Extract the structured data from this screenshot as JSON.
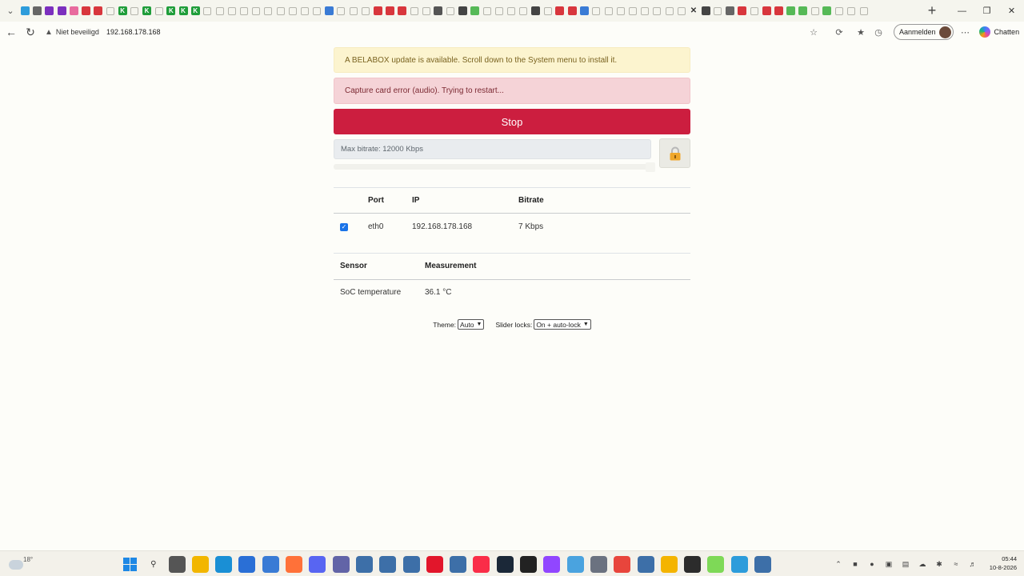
{
  "browser": {
    "tab_favicons": [
      "edge",
      "globe",
      "purple",
      "purple",
      "pink",
      "red",
      "red",
      "gray",
      "green-k",
      "gray",
      "green-k",
      "gray",
      "green-k",
      "green-k",
      "green-k",
      "gray",
      "gray",
      "gray",
      "gray",
      "gray",
      "gray",
      "gray",
      "gray",
      "gray",
      "gray",
      "blue",
      "gray",
      "gray",
      "gray",
      "red",
      "red",
      "red",
      "gray",
      "gray",
      "x",
      "gray",
      "dark",
      "green",
      "gray",
      "gray",
      "gray",
      "gray",
      "dark",
      "gray",
      "red",
      "red",
      "blue",
      "gray",
      "gray",
      "gray",
      "gray",
      "gray",
      "gray",
      "gray",
      "gray",
      "close",
      "dark",
      "gray",
      "globe",
      "red",
      "gray",
      "red",
      "red",
      "green",
      "green",
      "gray",
      "green",
      "gray",
      "gray",
      "gray"
    ],
    "close_tab_icon": "close-icon",
    "new_tab": "+",
    "security_label": "Niet beveiligd",
    "url": "192.168.178.168",
    "signin_label": "Aanmelden",
    "chat_label": "Chatten"
  },
  "page": {
    "alert_update": "A BELABOX update is available. Scroll down to the System menu to install it.",
    "alert_error": "Capture card error (audio). Trying to restart...",
    "stop_label": "Stop",
    "bitrate_label": "Max bitrate: 12000 Kbps",
    "bitrate_slider_fraction": 1.0,
    "lock_icon": "lock-icon",
    "network_table": {
      "headers": [
        "",
        "Port",
        "IP",
        "Bitrate"
      ],
      "rows": [
        {
          "enabled": true,
          "port": "eth0",
          "ip": "192.168.178.168",
          "bitrate": "7 Kbps"
        }
      ]
    },
    "sensor_table": {
      "headers": [
        "Sensor",
        "Measurement"
      ],
      "rows": [
        {
          "sensor": "SoC temperature",
          "measurement": "36.1 °C"
        }
      ]
    },
    "theme_label": "Theme:",
    "theme_value": "Auto",
    "slider_locks_label": "Slider locks:",
    "slider_locks_value": "On + auto-lock"
  },
  "taskbar": {
    "weather_temp": "18°",
    "clock_time": "05:44",
    "clock_date": "10-8-2026",
    "apps": [
      "windows-start",
      "search",
      "file",
      "explorer",
      "edge",
      "store",
      "mail",
      "firefox",
      "discord",
      "teams",
      "app",
      "app",
      "app",
      "opera",
      "app",
      "music",
      "steam",
      "media",
      "twitch",
      "tool",
      "settings",
      "chrome",
      "app",
      "explorer-folder",
      "terminal",
      "android",
      "notepad",
      "app"
    ]
  }
}
